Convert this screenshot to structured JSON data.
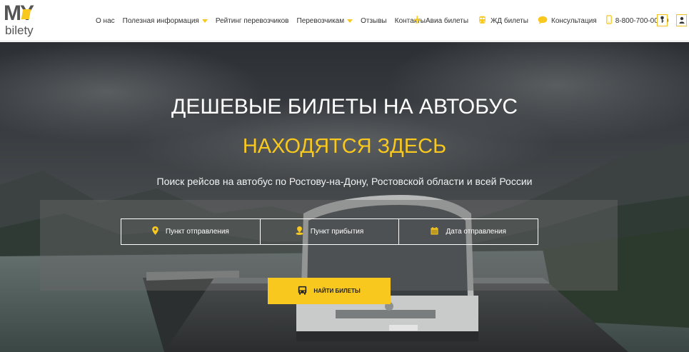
{
  "header": {
    "logo": {
      "top": "MY",
      "bottom": "bilety"
    },
    "nav": [
      {
        "label": "О нас",
        "dropdown": false
      },
      {
        "label": "Полезная информация",
        "dropdown": true
      },
      {
        "label": "Рейтинг перевозчиков",
        "dropdown": false
      },
      {
        "label": "Перевозчикам",
        "dropdown": true
      },
      {
        "label": "Отзывы",
        "dropdown": false
      },
      {
        "label": "Контакты",
        "dropdown": false
      }
    ],
    "services": [
      {
        "label": "Авиа билеты",
        "icon": "plane-icon"
      },
      {
        "label": "ЖД билеты",
        "icon": "train-icon"
      },
      {
        "label": "Консультация",
        "icon": "chat-icon"
      }
    ],
    "phone": "8-800-700-00-00"
  },
  "hero": {
    "title": "ДЕШЕВЫЕ БИЛЕТЫ НА АВТОБУС",
    "subtitle": "НАХОДЯТСЯ ЗДЕСЬ",
    "description": "Поиск рейсов на автобус по Ростову-на-Дону, Ростовской области и всей России"
  },
  "search": {
    "from": "Пункт отправления",
    "to": "Пункт прибытия",
    "date": "Дата отправления",
    "button": "НАЙТИ БИЛЕТЫ"
  },
  "colors": {
    "accent": "#f8c81e",
    "text": "#333333"
  }
}
